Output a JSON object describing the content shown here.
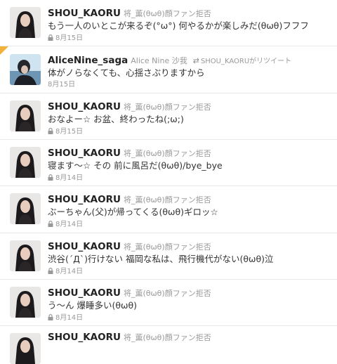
{
  "tweets": [
    {
      "name": "SHOU_KAORU",
      "handle": "将_薫(θωθ)顔ファン拒否",
      "text": "もう一人のいとこが来るぞ(°ω°) 何やるかが楽しみだ(θωθ)フフフ",
      "date": "8月15日",
      "locked": true,
      "retweet": false
    },
    {
      "name": "AliceNine_saga",
      "handle": "Alice Nine 沙我",
      "rt_label": "SHOU_KAORUがリツイート",
      "text": "体がノらなくても、心揺さぶりますから",
      "date": "8月15日",
      "locked": false,
      "retweet": true
    },
    {
      "name": "SHOU_KAORU",
      "handle": "将_薫(θωθ)顔ファン拒否",
      "text": "おなよー☆ お盆、終わったね(;ω;)",
      "date": "8月15日",
      "locked": true,
      "retweet": false
    },
    {
      "name": "SHOU_KAORU",
      "handle": "将_薫(θωθ)顔ファン拒否",
      "text": "寝ます～☆ その 前に風呂だ(θωθ)/bye_bye",
      "date": "8月14日",
      "locked": true,
      "retweet": false
    },
    {
      "name": "SHOU_KAORU",
      "handle": "将_薫(θωθ)顔ファン拒否",
      "text": "ぶーちゃん(父)が帰ってくる(θωθ)ギロッ☆",
      "date": "8月14日",
      "locked": true,
      "retweet": false
    },
    {
      "name": "SHOU_KAORU",
      "handle": "将_薫(θωθ)顔ファン拒否",
      "text": "渋谷(´Д`)行けない 福岡な私は、飛行機代がない(θωθ)泣",
      "date": "8月14日",
      "locked": true,
      "retweet": false
    },
    {
      "name": "SHOU_KAORU",
      "handle": "将_薫(θωθ)顔ファン拒否",
      "text": "う～ん 爆睡多い(θωθ)",
      "date": "8月14日",
      "locked": true,
      "retweet": false
    },
    {
      "name": "SHOU_KAORU",
      "handle": "将_薫(θωθ)顔ファン拒否",
      "text": "",
      "date": "",
      "locked": true,
      "retweet": false
    }
  ]
}
